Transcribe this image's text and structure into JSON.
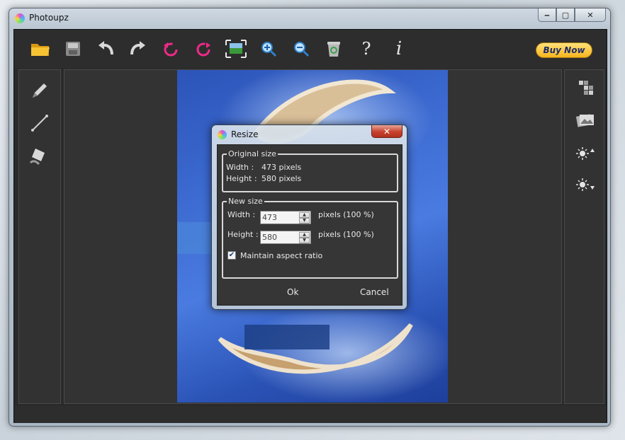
{
  "window": {
    "title": "Photoupz",
    "minimize": "‒",
    "maximize": "▢",
    "close": "✕"
  },
  "toolbar": {
    "items": [
      {
        "name": "open-folder-icon"
      },
      {
        "name": "save-icon"
      },
      {
        "name": "undo-icon"
      },
      {
        "name": "redo-icon"
      },
      {
        "name": "rotate-left-icon"
      },
      {
        "name": "rotate-right-icon"
      },
      {
        "name": "resize-icon"
      },
      {
        "name": "zoom-in-icon"
      },
      {
        "name": "zoom-out-icon"
      },
      {
        "name": "recycle-bin-icon"
      },
      {
        "name": "help-icon"
      },
      {
        "name": "info-icon"
      }
    ],
    "help_glyph": "?",
    "info_glyph": "i",
    "buy_label": "Buy Now"
  },
  "left_tools": [
    "pencil-icon",
    "line-icon",
    "paint-bucket-icon"
  ],
  "right_tools": [
    "pixelate-icon",
    "photo-effect-icon",
    "brightness-up-icon",
    "brightness-down-icon"
  ],
  "dialog": {
    "title": "Resize",
    "close": "✕",
    "original": {
      "legend": "Original size",
      "width_label": "Width :",
      "width_value": "473 pixels",
      "height_label": "Height :",
      "height_value": "580 pixels"
    },
    "new_size": {
      "legend": "New size",
      "width_label": "Width :",
      "width_value": "473",
      "width_suffix": "pixels (100 %)",
      "height_label": "Height :",
      "height_value": "580",
      "height_suffix": "pixels (100 %)",
      "aspect_label": "Maintain aspect ratio",
      "aspect_checked": true,
      "check_glyph": "✔"
    },
    "ok_label": "Ok",
    "cancel_label": "Cancel"
  },
  "colors": {
    "accent": "#f5b51e",
    "panel": "#323232",
    "dialog_close": "#c7412d"
  }
}
